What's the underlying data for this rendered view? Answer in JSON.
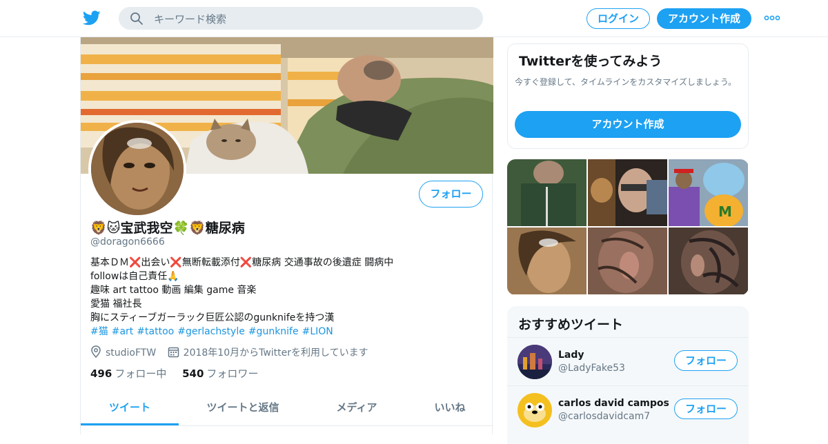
{
  "header": {
    "search_placeholder": "キーワード検索",
    "login_label": "ログイン",
    "signup_label": "アカウント作成"
  },
  "profile": {
    "follow_label": "フォロー",
    "display_name": "🦁🐱宝武我空🍀🦁糖尿病",
    "handle": "@doragon6666",
    "bio_lines": [
      "基本ＤＭ❌出会い❌無断転載添付❌糖尿病 交通事故の後遺症 闘病中",
      "followは自己責任🙏",
      "趣味 art tattoo 動画 編集 game 音楽",
      "愛猫 福社長",
      "胸にスティーブガーラック巨匠公認のgunknifeを持つ漢"
    ],
    "hashtags": [
      "#猫",
      "#art",
      "#tattoo",
      "#gerlachstyle",
      "#gunknife",
      "#LION"
    ],
    "location": "studioFTW",
    "joined": "2018年10月からTwitterを利用しています",
    "following_count": "496",
    "following_label": "フォロー中",
    "followers_count": "540",
    "followers_label": "フォロワー"
  },
  "tabs": [
    "ツイート",
    "ツイートと返信",
    "メディア",
    "いいね"
  ],
  "active_tab": 0,
  "signup_card": {
    "title": "Twitterを使ってみよう",
    "description": "今すぐ登録して、タイムラインをカスタマイズしましょう。",
    "button_label": "アカウント作成"
  },
  "recommended": {
    "title": "おすすめツイート",
    "users": [
      {
        "name": "Lady",
        "handle": "@LadyFake53",
        "follow_label": "フォロー"
      },
      {
        "name": "carlos david campos",
        "handle": "@carlosdavidcam7",
        "follow_label": "フォロー"
      }
    ]
  },
  "colors": {
    "accent": "#1da1f2",
    "text": "#14171a",
    "muted": "#657786",
    "border": "#e6ecf0"
  }
}
